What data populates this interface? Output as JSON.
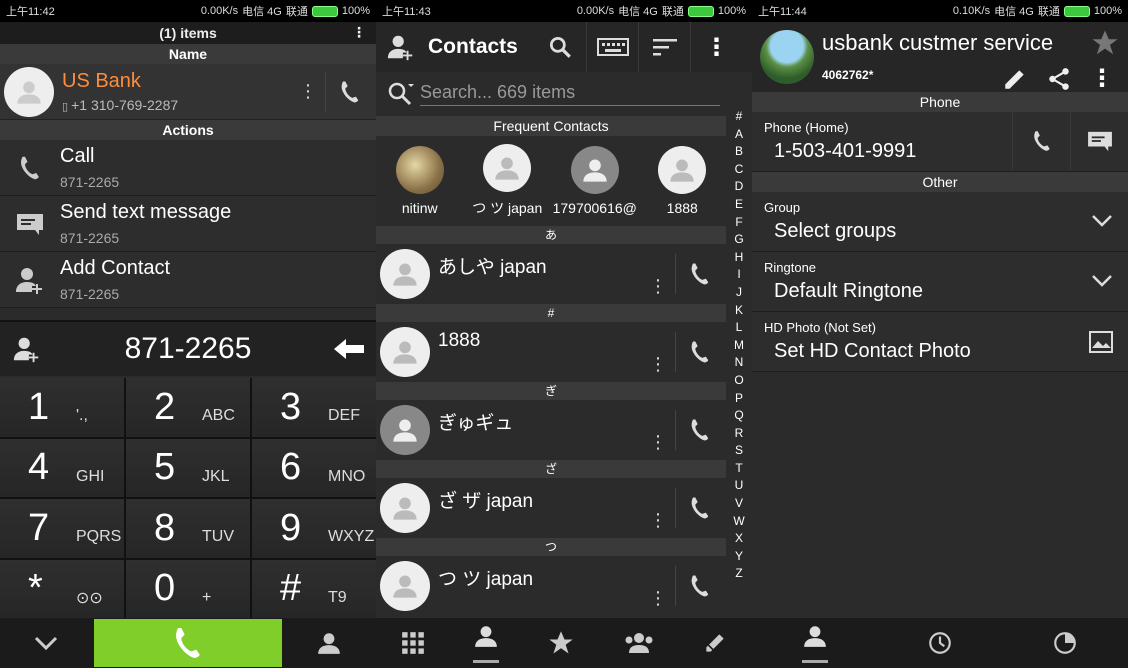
{
  "screen1": {
    "status": {
      "time": "上午11:42",
      "speed": "0.00K/s",
      "carrier": "电信 4G",
      "carrier2": "联通",
      "battery": "100%"
    },
    "top_title": "(1) items",
    "name_header": "Name",
    "contact": {
      "name": "US Bank",
      "number": "+1 310-769-2287"
    },
    "actions_header": "Actions",
    "actions": [
      {
        "title": "Call",
        "sub": "871-2265"
      },
      {
        "title": "Send text message",
        "sub": "871-2265"
      },
      {
        "title": "Add Contact",
        "sub": "871-2265"
      }
    ],
    "dialed": "871-2265",
    "keys": [
      {
        "d": "1",
        "l": "'.,"
      },
      {
        "d": "2",
        "l": "ABC"
      },
      {
        "d": "3",
        "l": "DEF"
      },
      {
        "d": "4",
        "l": "GHI"
      },
      {
        "d": "5",
        "l": "JKL"
      },
      {
        "d": "6",
        "l": "MNO"
      },
      {
        "d": "7",
        "l": "PQRS"
      },
      {
        "d": "8",
        "l": "TUV"
      },
      {
        "d": "9",
        "l": "WXYZ"
      },
      {
        "d": "*",
        "l": ""
      },
      {
        "d": "0",
        "l": "+"
      },
      {
        "d": "#",
        "l": "T9"
      }
    ],
    "accent": "#7fce2a"
  },
  "screen2": {
    "status": {
      "time": "上午11:43",
      "speed": "0.00K/s",
      "carrier": "电信 4G",
      "carrier2": "联通",
      "battery": "100%"
    },
    "title": "Contacts",
    "search_placeholder": "Search... 669 items",
    "frequent_header": "Frequent Contacts",
    "frequent": [
      "nitinw",
      "つ ツ japan",
      "179700616@",
      "1888"
    ],
    "groups": [
      {
        "index": "あ",
        "name": "あしや japan"
      },
      {
        "index": "#",
        "name": "1888"
      },
      {
        "index": "ぎ",
        "name": "ぎゅギュ"
      },
      {
        "index": "ざ",
        "name": "ざ ザ japan"
      },
      {
        "index": "つ",
        "name": "つ ツ japan"
      }
    ],
    "alphabet": [
      "#",
      "A",
      "B",
      "C",
      "D",
      "E",
      "F",
      "G",
      "H",
      "I",
      "J",
      "K",
      "L",
      "M",
      "N",
      "O",
      "P",
      "Q",
      "R",
      "S",
      "T",
      "U",
      "V",
      "W",
      "X",
      "Y",
      "Z"
    ]
  },
  "screen3": {
    "status": {
      "time": "上午11:44",
      "speed": "0.10K/s",
      "carrier": "电信 4G",
      "carrier2": "联通",
      "battery": "100%"
    },
    "name": "usbank custmer service",
    "sub": "4062762*",
    "phone_header": "Phone",
    "phone_label": "Phone  (Home)",
    "phone_value": "1-503-401-9991",
    "other_header": "Other",
    "group_label": "Group",
    "group_value": "Select groups",
    "ringtone_label": "Ringtone",
    "ringtone_value": "Default Ringtone",
    "hd_label": "HD Photo (Not Set)",
    "hd_value": "Set HD Contact Photo"
  }
}
